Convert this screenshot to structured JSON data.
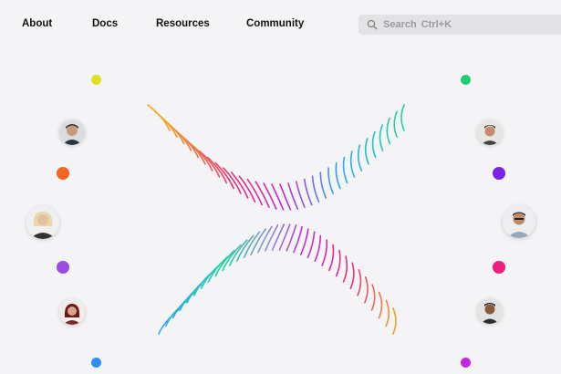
{
  "nav": {
    "links": [
      {
        "label": "About"
      },
      {
        "label": "Docs"
      },
      {
        "label": "Resources"
      },
      {
        "label": "Community"
      }
    ]
  },
  "search": {
    "placeholder": "Search",
    "shortcut": "Ctrl+K",
    "icon": "search-icon"
  },
  "dot_colors": {
    "left_top": "#e0e020",
    "left_mid1": "#f26522",
    "left_mid2": "#9b4de0",
    "left_bottom": "#2d8ff0",
    "right_top": "#22cc77",
    "right_mid1": "#7a22e6",
    "right_mid2": "#ef1e7e",
    "right_bottom": "#c626e0"
  },
  "logo": {
    "icon": "x-logo-icon",
    "gradient_colors": [
      "#f5a623",
      "#e5317b",
      "#c12bd6",
      "#6a5cf5",
      "#2da8f0",
      "#22d3a0",
      "#8bd94a"
    ]
  }
}
